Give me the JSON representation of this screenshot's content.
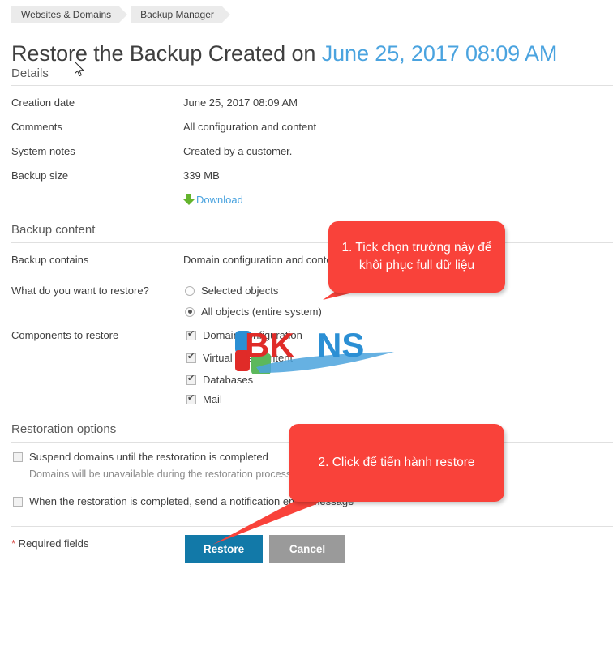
{
  "breadcrumb": {
    "items": [
      {
        "label": "Websites & Domains"
      },
      {
        "label": "Backup Manager"
      }
    ]
  },
  "page": {
    "title_prefix": "Restore the Backup Created on ",
    "title_date": "June 25, 2017 08:09 AM"
  },
  "details": {
    "heading": "Details",
    "rows": [
      {
        "label": "Creation date",
        "value": "June 25, 2017 08:09 AM"
      },
      {
        "label": "Comments",
        "value": "All configuration and content"
      },
      {
        "label": "System notes",
        "value": "Created by a customer."
      },
      {
        "label": "Backup size",
        "value": "339 MB"
      }
    ],
    "download_label": "Download",
    "download_icon": "download-arrow-icon"
  },
  "backup_content": {
    "heading": "Backup content",
    "contains_label": "Backup contains",
    "contains_value": "Domain configuration and content",
    "restore_question_label": "What do you want to restore?",
    "restore_options": [
      {
        "label": "Selected objects",
        "checked": false
      },
      {
        "label": "All objects (entire system)",
        "checked": true
      }
    ],
    "components_label": "Components to restore",
    "components": [
      {
        "label": "Domain configuration",
        "checked": true
      },
      {
        "label": "Virtual host content",
        "checked": true
      },
      {
        "label": "Databases",
        "checked": true
      },
      {
        "label": "Mail",
        "checked": true
      }
    ]
  },
  "restoration_options": {
    "heading": "Restoration options",
    "suspend": {
      "label": "Suspend domains until the restoration is completed",
      "note": "Domains will be unavailable during the restoration process.",
      "checked": false
    },
    "notify": {
      "label": "When the restoration is completed, send a notification email message",
      "checked": false
    }
  },
  "footer": {
    "required_star": "*",
    "required_label": " Required fields",
    "restore_button": "Restore",
    "cancel_button": "Cancel"
  },
  "callouts": [
    {
      "id": "callout-tick-field",
      "text": "1. Tick chọn trường này để khôi phục full dữ liệu",
      "color": "#f9423a"
    },
    {
      "id": "callout-click-restore",
      "text": "2. Click để tiến hành restore",
      "color": "#f9423a"
    }
  ],
  "watermark": {
    "text_bk": "BK",
    "text_n": "N",
    "text_s": "S",
    "color_bk": "#e02b28",
    "color_ns": "#2b8fd4",
    "color_square_blue": "#2b8fd4",
    "color_square_red": "#e02b28",
    "color_square_green": "#5cb85c"
  },
  "colors": {
    "accent_blue": "#4aa3df",
    "primary_button": "#1279a8",
    "secondary_button": "#9a9a9a",
    "callout_red": "#f9423a",
    "download_green": "#64b42d",
    "required_red": "#d9534f"
  }
}
